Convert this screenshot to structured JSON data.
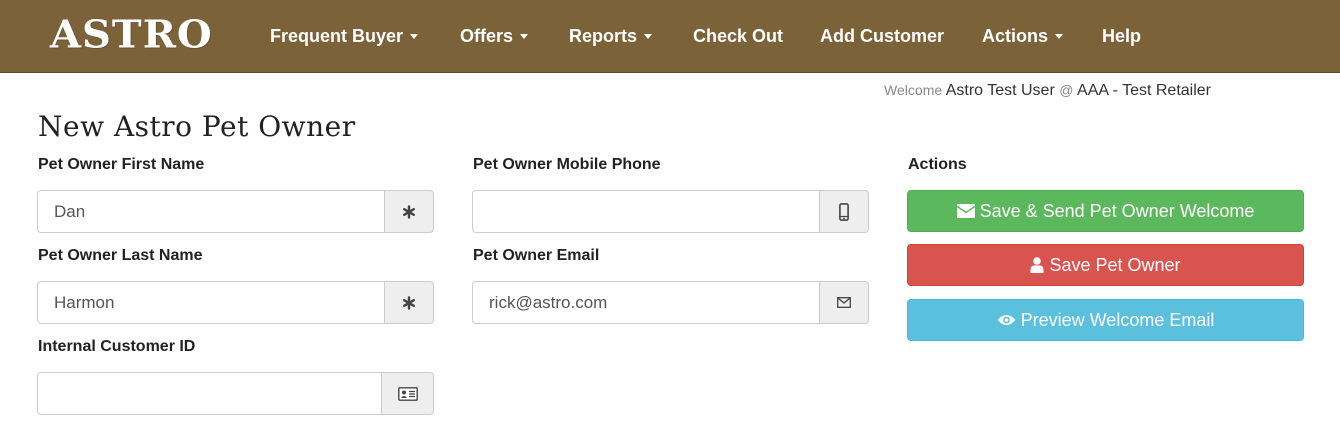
{
  "brand": {
    "logo_text": "ASTRO",
    "nav_bg": "#7b6239"
  },
  "nav": {
    "frequent_buyer": "Frequent Buyer",
    "offers": "Offers",
    "reports": "Reports",
    "check_out": "Check Out",
    "add_customer": "Add Customer",
    "actions": "Actions",
    "help": "Help"
  },
  "welcome": {
    "prefix": "Welcome",
    "user": "Astro Test User",
    "at": "@",
    "retailer": "AAA - Test Retailer"
  },
  "page_title": "New Astro Pet Owner",
  "form": {
    "first_name": {
      "label": "Pet Owner First Name",
      "value": "Dan",
      "icon": "asterisk-icon"
    },
    "last_name": {
      "label": "Pet Owner Last Name",
      "value": "Harmon",
      "icon": "asterisk-icon"
    },
    "customer_id": {
      "label": "Internal Customer ID",
      "value": "",
      "icon": "id-card-icon"
    },
    "mobile_phone": {
      "label": "Pet Owner Mobile Phone",
      "value": "",
      "icon": "mobile-icon"
    },
    "email": {
      "label": "Pet Owner Email",
      "value": "rick@astro.com",
      "icon": "envelope-icon"
    }
  },
  "actions": {
    "heading": "Actions",
    "save_send": {
      "label": "Save & Send Pet Owner Welcome",
      "color": "#5cb85c",
      "icon": "envelope-icon"
    },
    "save": {
      "label": "Save Pet Owner",
      "color": "#d9534f",
      "icon": "user-icon"
    },
    "preview": {
      "label": "Preview Welcome Email",
      "color": "#5bc0de",
      "icon": "eye-icon"
    }
  }
}
